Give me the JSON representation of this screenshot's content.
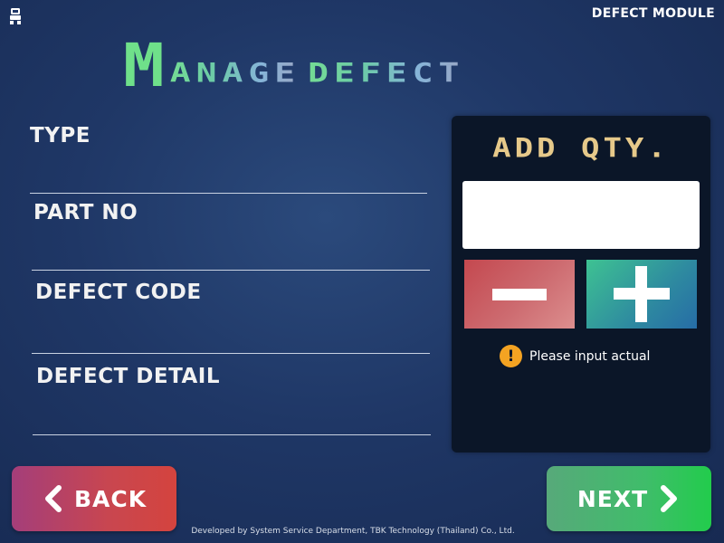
{
  "header": {
    "module_label": "DEFECT MODULE",
    "title_initial": "M",
    "title_rest": "anage",
    "title_second": "defect"
  },
  "form": {
    "fields": [
      {
        "label": "TYPE",
        "value": ""
      },
      {
        "label": "PART NO",
        "value": ""
      },
      {
        "label": "DEFECT CODE",
        "value": ""
      },
      {
        "label": "DEFECT DETAIL",
        "value": ""
      }
    ]
  },
  "qty_panel": {
    "title": "ADD QTY.",
    "input_value": "",
    "minus_icon": "minus-icon",
    "plus_icon": "plus-icon",
    "hint_icon": "!",
    "hint_text": "Please input actual"
  },
  "nav": {
    "back_label": "BACK",
    "next_label": "NEXT"
  },
  "footer": {
    "text": "Developed by System Service Department, TBK Technology (Thailand) Co., Ltd."
  },
  "colors": {
    "background": "#1f3766",
    "panel": "#0b1628",
    "title_green": "#6fe08a",
    "qty_title": "#e6c98a",
    "minus_button": "#c4484f",
    "plus_button": "#2e8aa0",
    "warning": "#f4a322",
    "back_button": "#c9464f",
    "next_button": "#3fbd6a"
  }
}
